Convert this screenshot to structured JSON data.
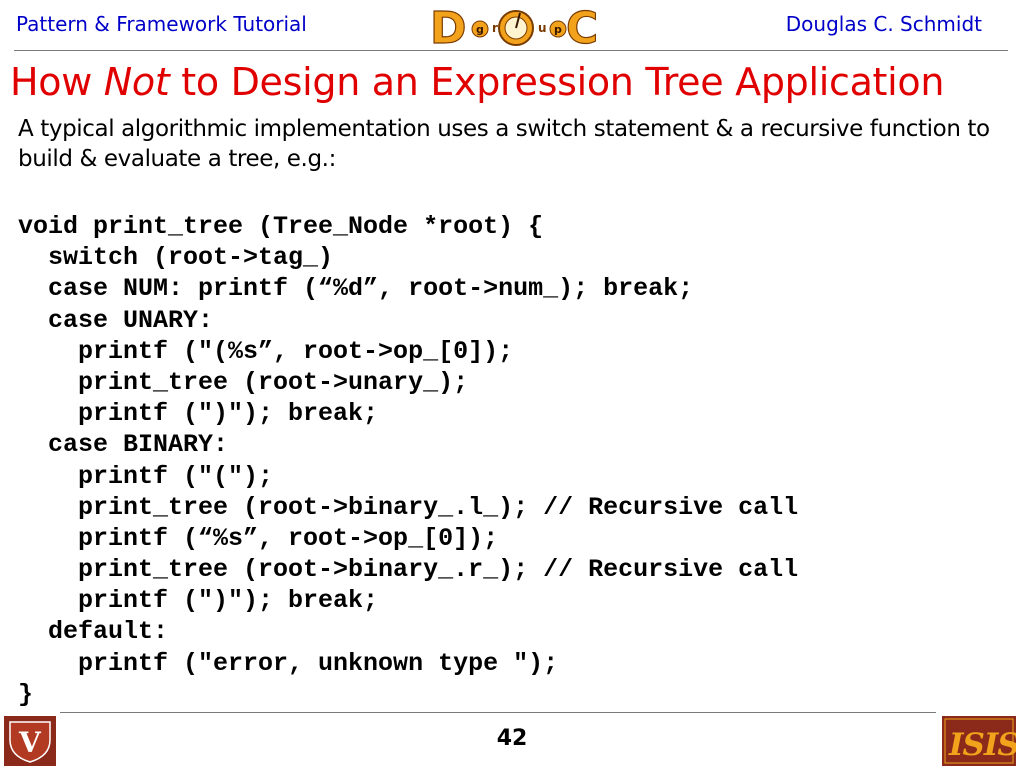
{
  "header": {
    "left_text": "Pattern & Framework Tutorial",
    "right_text": "Douglas C. Schmidt",
    "logo": {
      "icon": "doc-group-logo-icon",
      "letters": [
        "D",
        "g",
        "r",
        "o",
        "u",
        "p",
        "C"
      ]
    }
  },
  "slide": {
    "title_part1": "How ",
    "title_emphasis": "Not",
    "title_part2": " to Design an Expression Tree Application",
    "intro": "A typical algorithmic implementation uses a switch statement & a recursive function to build & evaluate a tree, e.g.:",
    "code_lines": [
      "void print_tree (Tree_Node *root) {",
      "  switch (root->tag_)",
      "  case NUM: printf (“%d”, root->num_); break;",
      "  case UNARY:",
      "    printf (\"(%s”, root->op_[0]);",
      "    print_tree (root->unary_);",
      "    printf (\")\"); break;",
      "  case BINARY:",
      "    printf (\"(\");",
      "    print_tree (root->binary_.l_); // Recursive call",
      "    printf (“%s”, root->op_[0]);",
      "    print_tree (root->binary_.r_); // Recursive call",
      "    printf (\")\"); break;",
      "  default:",
      "    printf (\"error, unknown type \");",
      "}"
    ]
  },
  "footer": {
    "page_number": "42",
    "left_logo": {
      "icon": "vanderbilt-logo-icon",
      "letter": "V"
    },
    "right_logo": {
      "icon": "isis-logo-icon",
      "letters": "ISIS"
    }
  },
  "colors": {
    "header_text": "#0000c8",
    "title_text": "#e00000",
    "body_text": "#000000",
    "rule": "#7a7a7a",
    "logo_brown": "#8b2a1a",
    "logo_gold": "#f2a31b"
  }
}
